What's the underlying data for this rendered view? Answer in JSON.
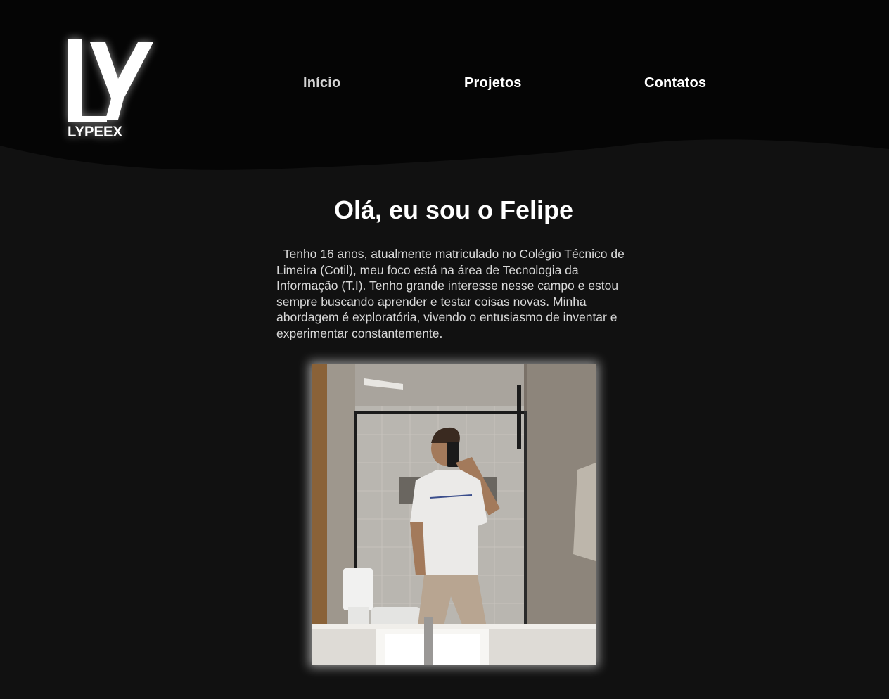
{
  "header": {
    "logo": {
      "monogram": "LY",
      "wordmark": "LYPEEX"
    },
    "nav": [
      {
        "label": "Início",
        "active": true
      },
      {
        "label": "Projetos",
        "active": false
      },
      {
        "label": "Contatos",
        "active": false
      }
    ]
  },
  "main": {
    "title": "Olá, eu sou o Felipe",
    "bio": "  Tenho 16 anos, atualmente matriculado no Colégio Técnico de Limeira (Cotil), meu foco está na área de Tecnologia da Informação (T.I). Tenho grande interesse nesse campo e estou sempre buscando aprender e testar coisas novas. Minha abordagem é exploratória, vivendo o entusiasmo de inventar e experimentar constantemente."
  },
  "colors": {
    "header_bg": "#050505",
    "page_bg": "#111111",
    "text_primary": "#ffffff",
    "text_secondary": "#d9d9d9"
  }
}
